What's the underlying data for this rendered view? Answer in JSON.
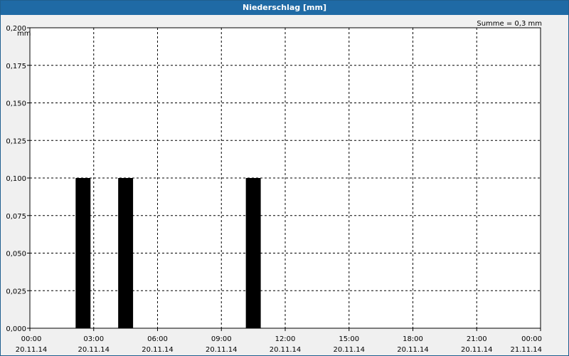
{
  "chart_data": {
    "type": "bar",
    "title": "Niederschlag [mm]",
    "ylabel": "mm",
    "annotation": "Summe = 0,3 mm",
    "ylim": [
      0,
      0.2
    ],
    "y_ticks": [
      "0,000",
      "0,025",
      "0,050",
      "0,075",
      "0,100",
      "0,125",
      "0,150",
      "0,175",
      "0,200"
    ],
    "x_ticks": [
      {
        "time": "00:00",
        "date": "20.11.14"
      },
      {
        "time": "03:00",
        "date": "20.11.14"
      },
      {
        "time": "06:00",
        "date": "20.11.14"
      },
      {
        "time": "09:00",
        "date": "20.11.14"
      },
      {
        "time": "12:00",
        "date": "20.11.14"
      },
      {
        "time": "15:00",
        "date": "20.11.14"
      },
      {
        "time": "18:00",
        "date": "20.11.14"
      },
      {
        "time": "21:00",
        "date": "20.11.14"
      },
      {
        "time": "00:00",
        "date": "21.11.14"
      }
    ],
    "xlim": [
      "20.11.14 00:00",
      "21.11.14 00:00"
    ],
    "bar_width_hours": 0.7,
    "bars": [
      {
        "time": "20.11.14 02:30",
        "value": 0.1
      },
      {
        "time": "20.11.14 04:30",
        "value": 0.1
      },
      {
        "time": "20.11.14 10:30",
        "value": 0.1
      }
    ],
    "grid": true,
    "colors": {
      "bar": "#000000",
      "title_bar": "#1f6aa5",
      "background": "#f0f0f0"
    }
  }
}
